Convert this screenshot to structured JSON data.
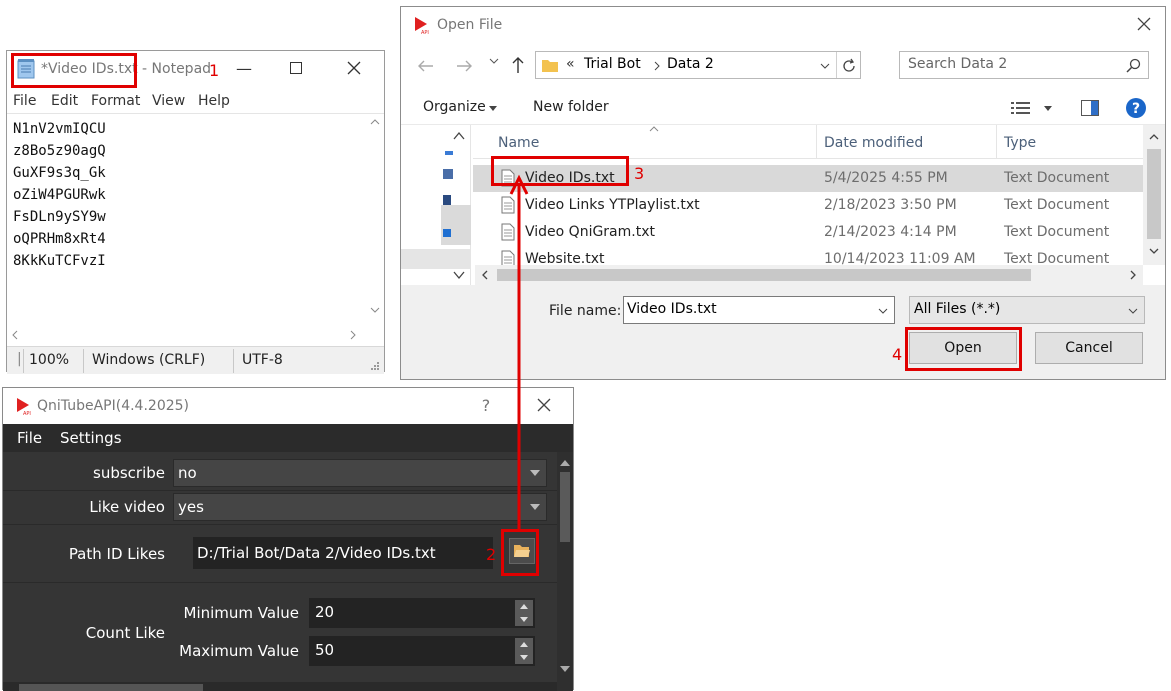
{
  "notepad": {
    "title_file": "*Video IDs.txt",
    "title_app": " - Notepad",
    "menu": [
      "File",
      "Edit",
      "Format",
      "View",
      "Help"
    ],
    "lines": [
      "N1nV2vmIQCU",
      "z8Bo5z90agQ",
      "GuXF9s3q_Gk",
      "oZiW4PGURwk",
      "FsDLn9ySY9w",
      "oQPRHm8xRt4",
      "8KkKuTCFvzI"
    ],
    "status": {
      "zoom": "100%",
      "eol": "Windows (CRLF)",
      "encoding": "UTF-8"
    }
  },
  "open_file": {
    "title": "Open File",
    "breadcrumb": {
      "sep": "«",
      "parts": [
        "Trial Bot",
        "Data 2"
      ]
    },
    "search_placeholder": "Search Data 2",
    "organize_label": "Organize",
    "new_folder_label": "New folder",
    "columns": {
      "name": "Name",
      "date": "Date modified",
      "type": "Type"
    },
    "files": [
      {
        "name": "Video IDs.txt",
        "date": "5/4/2025 4:55 PM",
        "type": "Text Document",
        "selected": true
      },
      {
        "name": "Video Links YTPlaylist.txt",
        "date": "2/18/2023 3:50 PM",
        "type": "Text Document",
        "selected": false
      },
      {
        "name": "Video QniGram.txt",
        "date": "2/14/2023 4:14 PM",
        "type": "Text Document",
        "selected": false
      },
      {
        "name": "Website.txt",
        "date": "10/14/2023 11:09 AM",
        "type": "Text Document",
        "selected": false
      }
    ],
    "file_name_label": "File name:",
    "file_name_value": "Video IDs.txt",
    "filter_value": "All Files (*.*)",
    "open_label": "Open",
    "cancel_label": "Cancel"
  },
  "qnitube": {
    "title": "QniTubeAPI(4.4.2025)",
    "help_glyph": "?",
    "menu": [
      "File",
      "Settings"
    ],
    "subscribe": {
      "label": "subscribe",
      "value": "no"
    },
    "like_video": {
      "label": "Like video",
      "value": "yes"
    },
    "path_id_likes": {
      "label": "Path ID Likes",
      "value": "D:/Trial Bot/Data 2/Video IDs.txt"
    },
    "count_like": {
      "label": "Count Like",
      "min_label": "Minimum Value",
      "min_value": "20",
      "max_label": "Maximum Value",
      "max_value": "50"
    }
  },
  "annotations": {
    "step1": "1",
    "step2": "2",
    "step3": "3",
    "step4": "4",
    "color": "#e00000"
  }
}
